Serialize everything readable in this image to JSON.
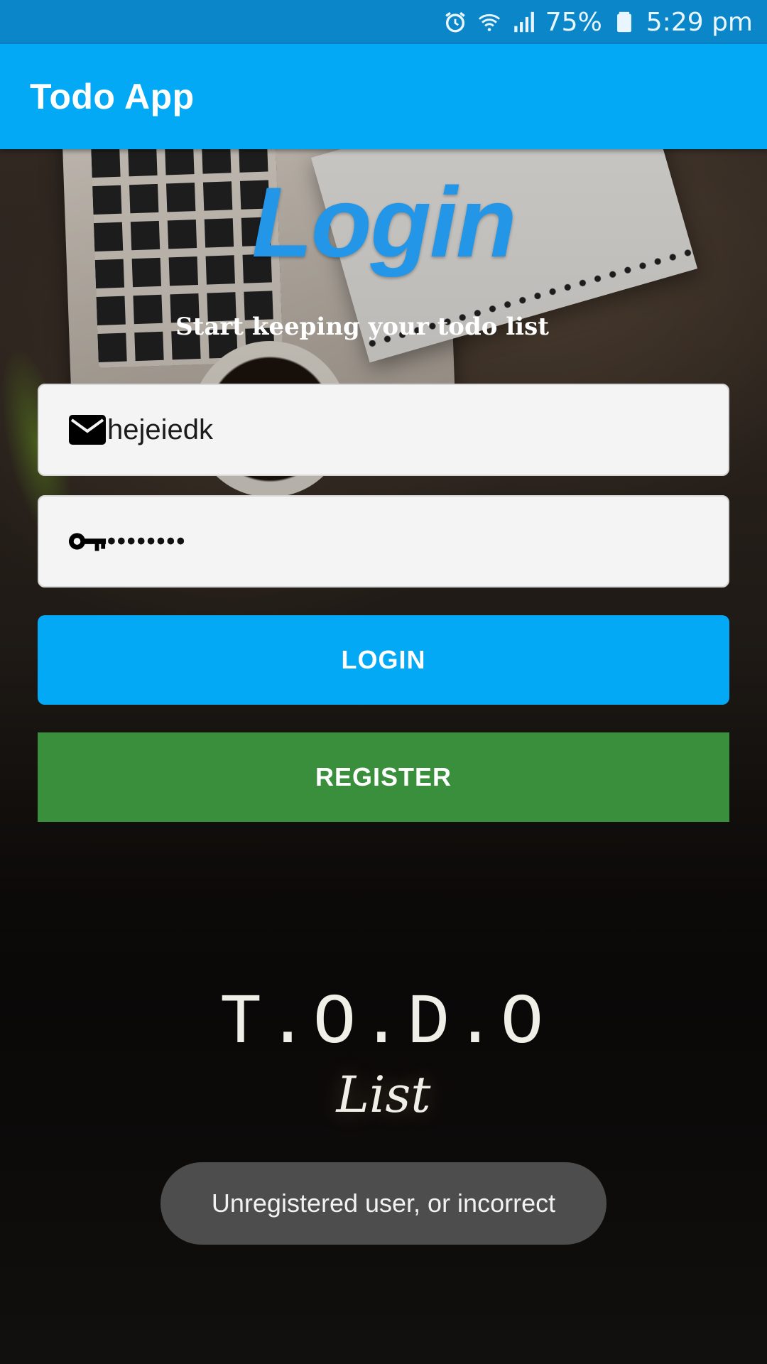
{
  "status_bar": {
    "battery": "75%",
    "time": "5:29 pm",
    "icons": [
      "alarm-icon",
      "wifi-icon",
      "signal-icon",
      "battery-icon"
    ]
  },
  "app_bar": {
    "title": "Todo App"
  },
  "login": {
    "title": "Login",
    "subtitle": "Start keeping your todo list"
  },
  "form": {
    "email": {
      "value": "hejeiedk",
      "icon": "mail-icon"
    },
    "password": {
      "value": "••••••••",
      "icon": "key-icon"
    }
  },
  "buttons": {
    "login": "LOGIN",
    "register": "REGISTER"
  },
  "logo": {
    "line1": "T.O.D.O",
    "line2": "List"
  },
  "toast": {
    "message": "Unregistered user, or incorrect"
  },
  "colors": {
    "status_bar": "#0a86c9",
    "app_bar": "#03a9f4",
    "login_button": "#03a9f4",
    "register_button": "#3a8f3d",
    "login_title": "#2496e8"
  }
}
